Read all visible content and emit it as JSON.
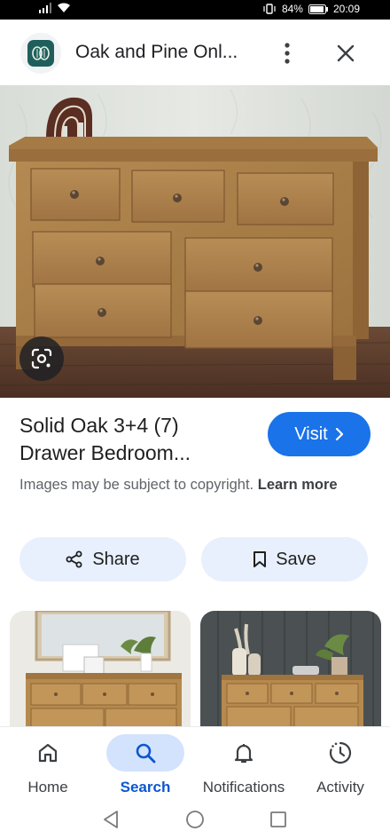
{
  "status_bar": {
    "battery": "84%",
    "time": "20:09"
  },
  "header": {
    "site_name": "Oak and Pine Onl...",
    "logo_icon": "site-favicon",
    "more_icon": "more-vert-icon",
    "close_icon": "close-icon"
  },
  "hero": {
    "image": "oak-chest-of-drawers-photo",
    "lens_icon": "google-lens-icon"
  },
  "result": {
    "title_line1": "Solid Oak 3+4 (7)",
    "title_line2": "Drawer Bedroom...",
    "visit_label": "Visit",
    "copyright_text": "Images may be subject to copyright.",
    "learn_more": "Learn more"
  },
  "actions": {
    "share_label": "Share",
    "save_label": "Save"
  },
  "bottom_nav": {
    "items": [
      {
        "label": "Home",
        "icon": "home-icon"
      },
      {
        "label": "Search",
        "icon": "search-icon"
      },
      {
        "label": "Notifications",
        "icon": "bell-icon"
      },
      {
        "label": "Activity",
        "icon": "activity-icon"
      }
    ],
    "active": "Search"
  },
  "colors": {
    "accent": "#1a73e8",
    "pill_bg": "#e8f0fe",
    "nav_active_bg": "#d3e3fd"
  }
}
